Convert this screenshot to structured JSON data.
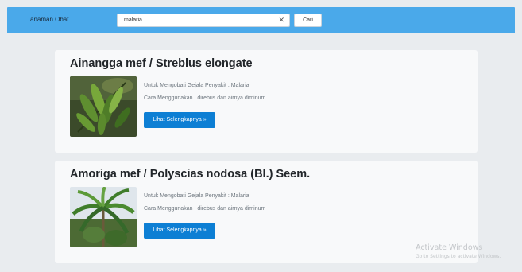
{
  "navbar": {
    "brand": "Tanaman Obat",
    "search_value": "malaria",
    "clear_icon": "x-icon",
    "search_button": "Cari",
    "color": "#4aa9ea"
  },
  "results": [
    {
      "title": "Ainangga mef / Streblus elongate",
      "disease": "Untuk Mengobati Gejala Penyakit : Malaria",
      "usage": "Cara Menggunakan : direbus dan airnya diminum",
      "button": "Lihat Selengkapnya »",
      "image": "leafy-branch-photo"
    },
    {
      "title": "Amoriga mef / Polyscias nodosa (Bl.) Seem.",
      "disease": "Untuk Mengobati Gejala Penyakit : Malaria",
      "usage": "Cara Menggunakan : direbus dan airnya diminum",
      "button": "Lihat Selengkapnya »",
      "image": "palm-tree-photo"
    }
  ],
  "watermark": {
    "title": "Activate Windows",
    "subtitle": "Go to Settings to activate Windows."
  },
  "colors": {
    "button_primary": "#0d7fd4",
    "card_bg": "#f8f9fa",
    "page_bg": "#e9ecef"
  }
}
